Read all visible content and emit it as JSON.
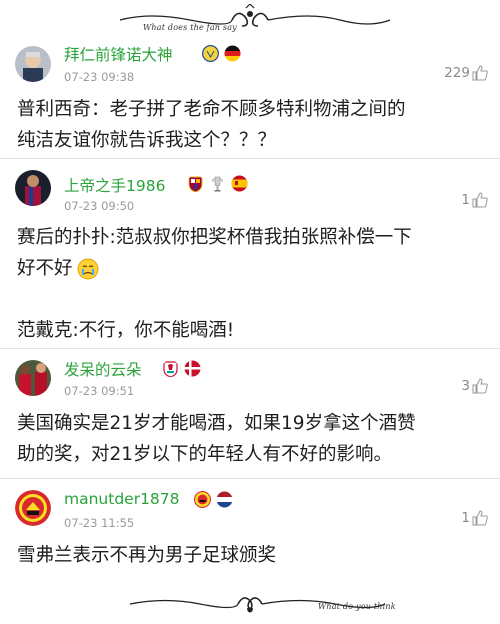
{
  "header": {
    "caption": "What does the fan say"
  },
  "footer": {
    "caption": "What do you think"
  },
  "comments": [
    {
      "username": "拜仁前锋诺大神",
      "timestamp": "07-23 09:38",
      "likes": "229",
      "badges": [
        "villarreal-crest-icon",
        "germany-flag-icon"
      ],
      "lines": [
        "普利西奇：老子拼了老命不顾多特利物浦之间的",
        "纯洁友谊你就告诉我这个？？？"
      ]
    },
    {
      "username": "上帝之手1986",
      "timestamp": "07-23 09:50",
      "likes": "1",
      "badges": [
        "barcelona-crest-icon",
        "trophy-icon",
        "spain-flag-icon"
      ],
      "lines": [
        "赛后的扑扑:范叔叔你把奖杯借我拍张照补偿一下",
        "好不好",
        "",
        "范戴克:不行，你不能喝酒!"
      ],
      "emoji": "crying-face-icon"
    },
    {
      "username": "发呆的云朵",
      "timestamp": "07-23 09:51",
      "likes": "3",
      "badges": [
        "liverpool-crest-icon",
        "denmark-flag-icon"
      ],
      "lines": [
        "美国确实是21岁才能喝酒，如果19岁拿这个酒赞",
        "助的奖，对21岁以下的年轻人有不好的影响。"
      ]
    },
    {
      "username": "manutder1878",
      "timestamp": "07-23 11:55",
      "likes": "1",
      "badges": [
        "manutd-crest-icon",
        "netherlands-flag-icon"
      ],
      "lines": [
        "雪弗兰表示不再为男子足球颁奖"
      ]
    }
  ]
}
